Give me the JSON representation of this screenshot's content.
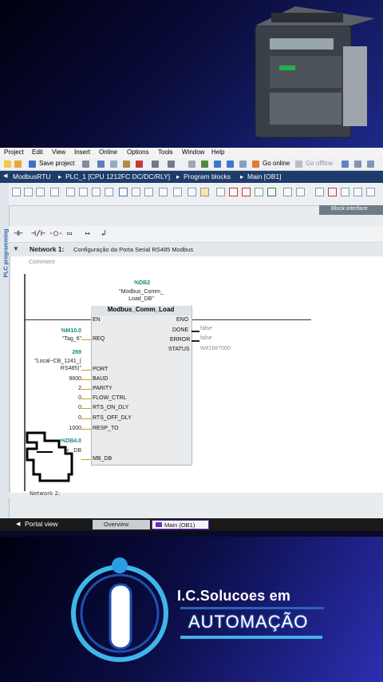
{
  "menubar": {
    "items": [
      "Project",
      "Edit",
      "View",
      "Insert",
      "Online",
      "Options",
      "Tools",
      "Window",
      "Help"
    ]
  },
  "toolbar": {
    "save_label": "Save project",
    "go_online": "Go online",
    "go_offline": "Go offline"
  },
  "breadcrumb": {
    "items": [
      "ModbusRTU",
      "PLC_1 [CPU 1212FC DC/DC/RLY]",
      "Program blocks",
      "Main [OB1]"
    ],
    "separator": "▸"
  },
  "sidebar": {
    "label": "PLC programming"
  },
  "block_interface": "Block interface",
  "network": {
    "header": "Network 1:",
    "title": "Configuração da Porta Serial RS485 Modbus",
    "comment": "Comment"
  },
  "fb": {
    "instance_addr": "%DB2",
    "instance_name": "\"Modbus_Comm_ Load_DB\"",
    "title": "Modbus_Comm_Load",
    "en": "EN",
    "eno": "ENO",
    "inputs": [
      {
        "pin": "REQ",
        "operand_addr": "%M10.0",
        "operand": "\"Tag_6\""
      },
      {
        "pin": "PORT",
        "operand_addr": "269",
        "operand": "\"Local~CB_1241_( RS485)\""
      },
      {
        "pin": "BAUD",
        "operand": "9600"
      },
      {
        "pin": "PARITY",
        "operand": "2"
      },
      {
        "pin": "FLOW_CTRL",
        "operand": "0"
      },
      {
        "pin": "RTS_ON_DLY",
        "operand": "0"
      },
      {
        "pin": "RTS_OFF_DLY",
        "operand": "0"
      },
      {
        "pin": "RESP_TO",
        "operand": "1000"
      },
      {
        "pin": "MB_DB",
        "operand_addr": "%DB4.0",
        "operand": "er_ DB"
      }
    ],
    "outputs": [
      {
        "pin": "DONE",
        "value": "false"
      },
      {
        "pin": "ERROR",
        "value": "false"
      },
      {
        "pin": "STATUS",
        "value": "W#16#7000"
      }
    ]
  },
  "network2": {
    "header": "Network 2:"
  },
  "statusbar": {
    "portal_view": "Portal view",
    "tab_overview": "Overview",
    "tab_main": "Main (OB1)"
  },
  "logo": {
    "line1": "I.C.Solucoes em",
    "line2": "AUTOMAÇÃO"
  },
  "colors": {
    "breadcrumb_bg": "#1d3c6b",
    "accent_teal": "#1a8a7a",
    "logo_cyan": "#41b3e6"
  }
}
